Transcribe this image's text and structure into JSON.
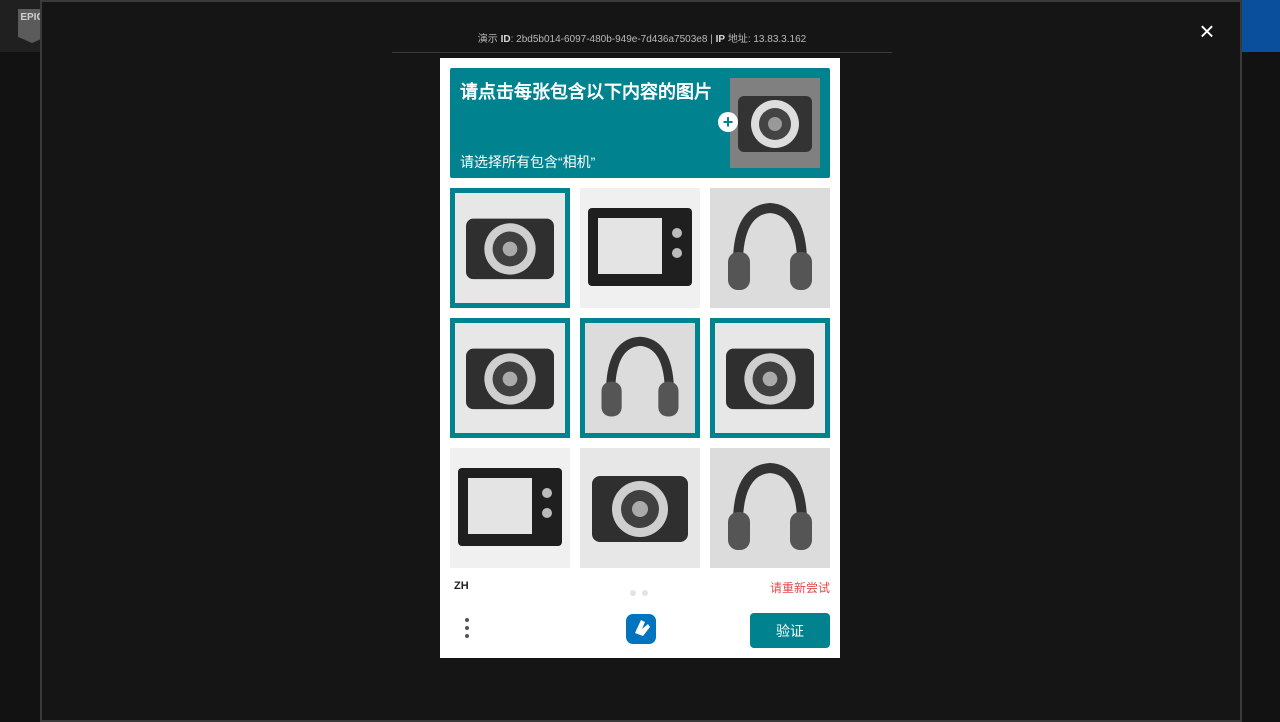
{
  "background": {
    "logo_text": "EPIC"
  },
  "modal": {
    "info_id_prefix": "演示",
    "info_id_label": "ID",
    "info_id_value": ": 2bd5b014-6097-480b-949e-7d436a7503e8 | ",
    "info_ip_label": "IP",
    "info_ip_suffix": "地址",
    "info_ip_value": ": 13.83.3.162",
    "close_label": "×"
  },
  "challenge": {
    "title": "请点击每张包含以下内容的图片",
    "subtitle": "请选择所有包含“相机”",
    "plus_label": "+",
    "prompt_image_icon": "camera-icon",
    "tiles": [
      {
        "label": "camera",
        "selected": true
      },
      {
        "label": "microwave",
        "selected": false
      },
      {
        "label": "headphones",
        "selected": false
      },
      {
        "label": "camera",
        "selected": true
      },
      {
        "label": "headphones",
        "selected": true
      },
      {
        "label": "camera",
        "selected": true
      },
      {
        "label": "microwave",
        "selected": false
      },
      {
        "label": "camera",
        "selected": false
      },
      {
        "label": "headphones",
        "selected": false
      }
    ],
    "language": "ZH",
    "error_text": "请重新尝试",
    "verify_label": "验证",
    "accent_color": "#00838f"
  }
}
